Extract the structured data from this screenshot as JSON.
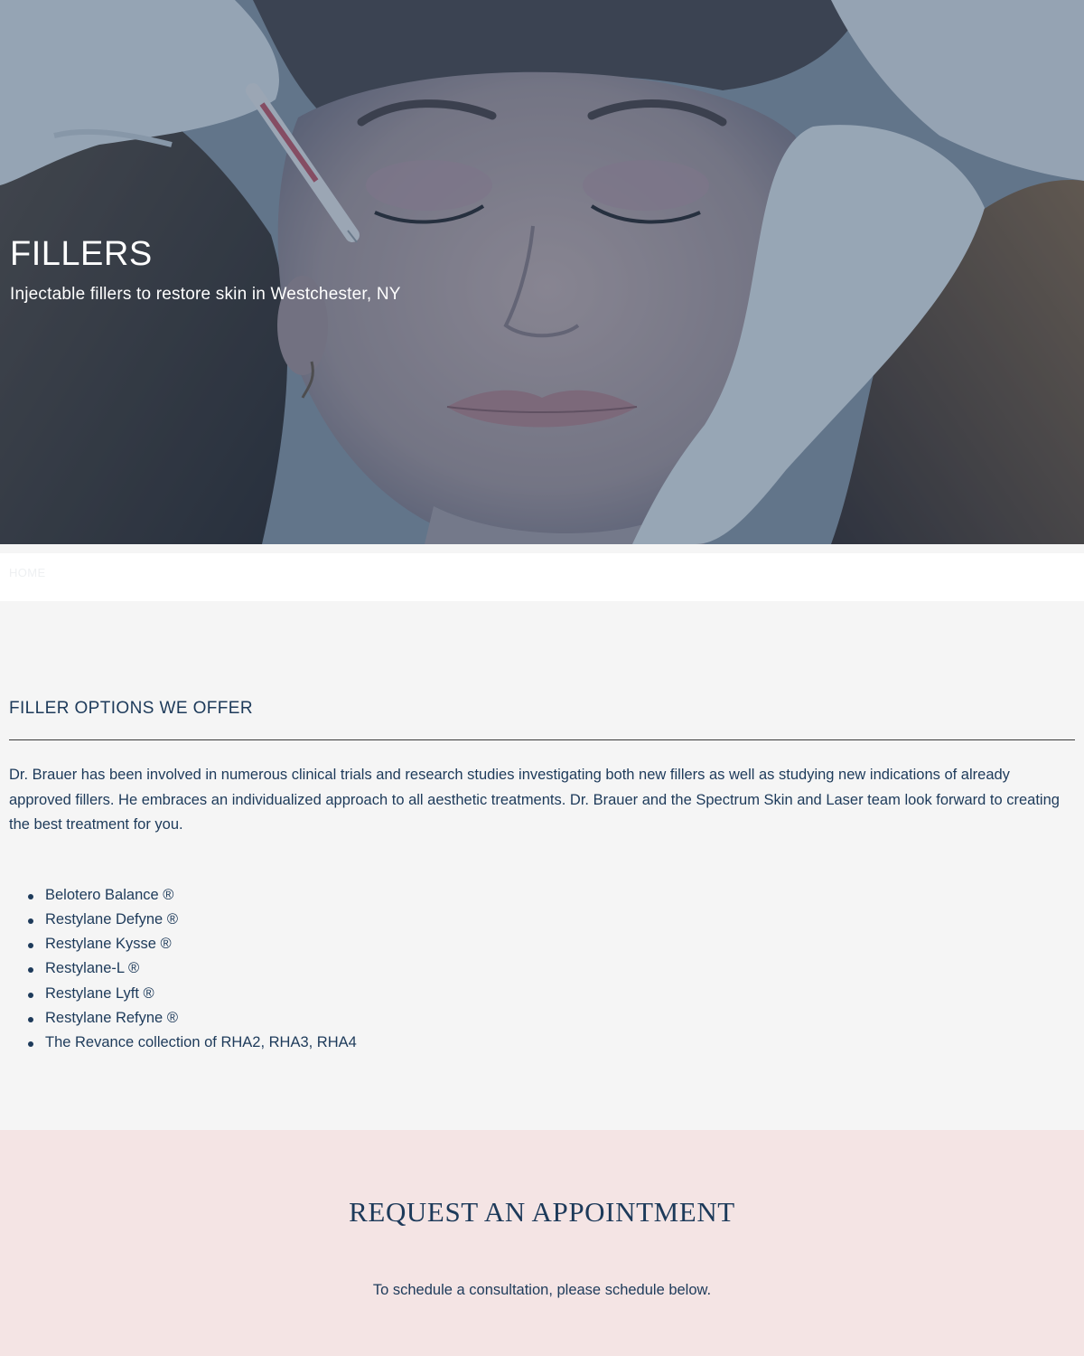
{
  "hero": {
    "title": "FILLERS",
    "subtitle": "Injectable fillers to restore skin in Westchester, NY"
  },
  "breadcrumb": {
    "home_label": "HOME"
  },
  "fillers_section": {
    "heading": "FILLER OPTIONS WE OFFER",
    "intro": "Dr. Brauer has been involved in numerous clinical trials and research studies investigating both new fillers as well as studying new indications of already approved fillers. He embraces an individualized approach to all aesthetic treatments. Dr. Brauer and the Spectrum Skin and Laser team look forward to creating the best treatment for you.",
    "items": [
      "Belotero Balance ®",
      "Restylane Defyne ®",
      "Restylane Kysse ®",
      "Restylane-L ®",
      "Restylane Lyft ®",
      "Restylane Refyne ®",
      "The Revance collection of RHA2, RHA3, RHA4"
    ]
  },
  "appointment": {
    "title": "REQUEST AN APPOINTMENT",
    "text": "To schedule a consultation, please schedule below."
  },
  "colors": {
    "navy": "#1d3a5a",
    "page_bg": "#f5f5f5",
    "appointment_bg": "#f4e4e4",
    "hero_overlay": "#1d3a5a"
  }
}
